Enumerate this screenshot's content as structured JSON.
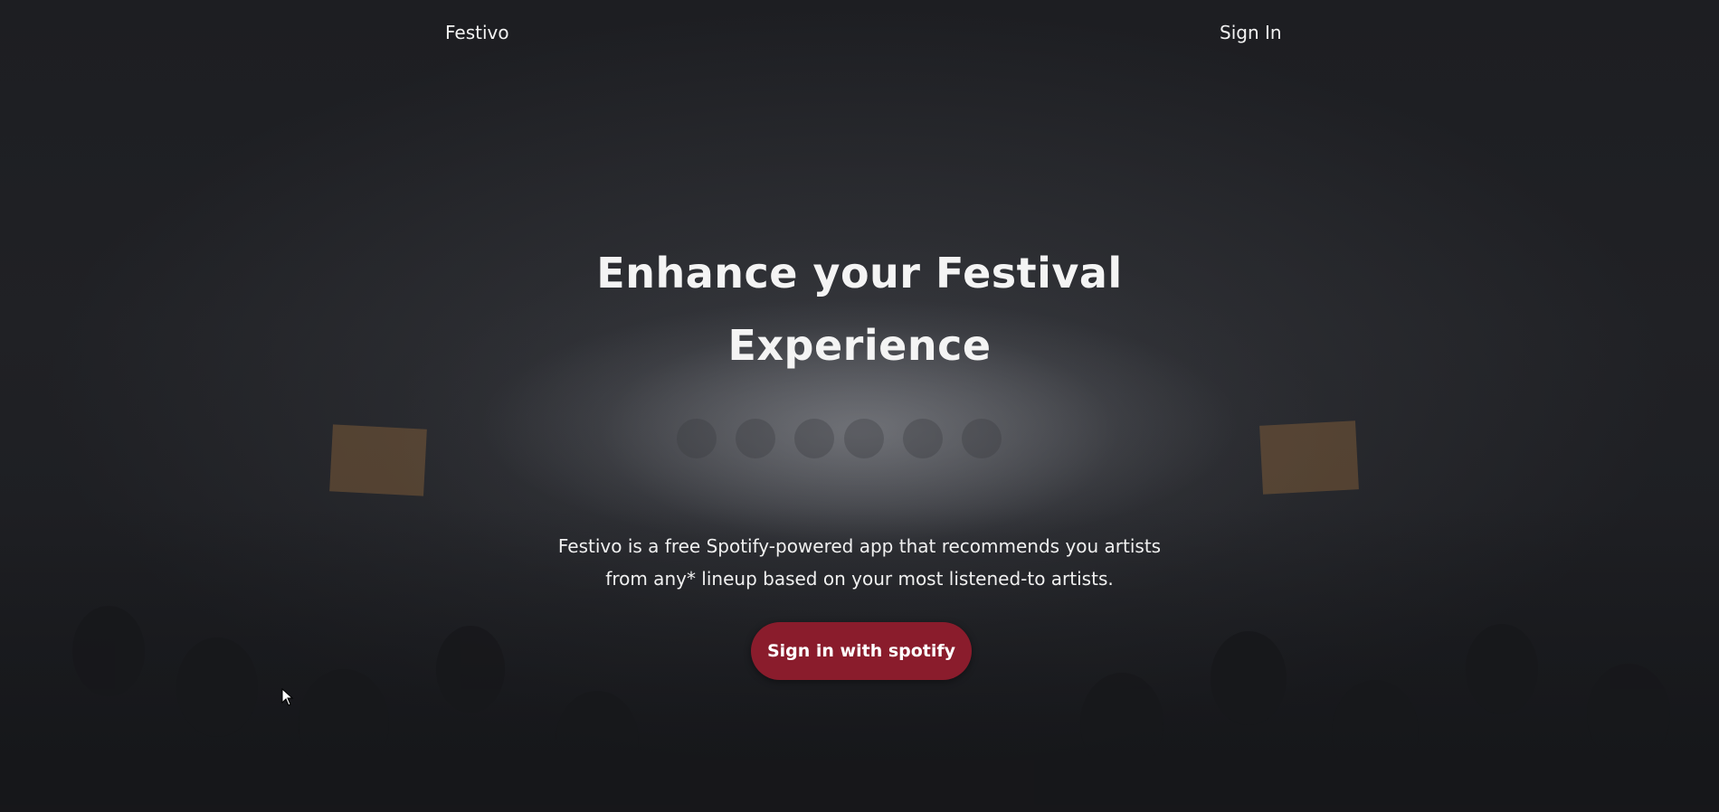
{
  "nav": {
    "brand": "Festivo",
    "sign_in": "Sign In"
  },
  "hero": {
    "title_line1": "Enhance your Festival",
    "title_line2": "Experience",
    "description_line1": "Festivo is a free Spotify-powered app that recommends you artists",
    "description_line2": "from any* lineup based on your most listened-to artists.",
    "cta_label": "Sign in with spotify"
  },
  "colors": {
    "background": "#1c1d21",
    "cta": "#8a1c2c",
    "text": "#f2f2f2"
  },
  "icons": {
    "cursor": "mouse-pointer-icon"
  }
}
